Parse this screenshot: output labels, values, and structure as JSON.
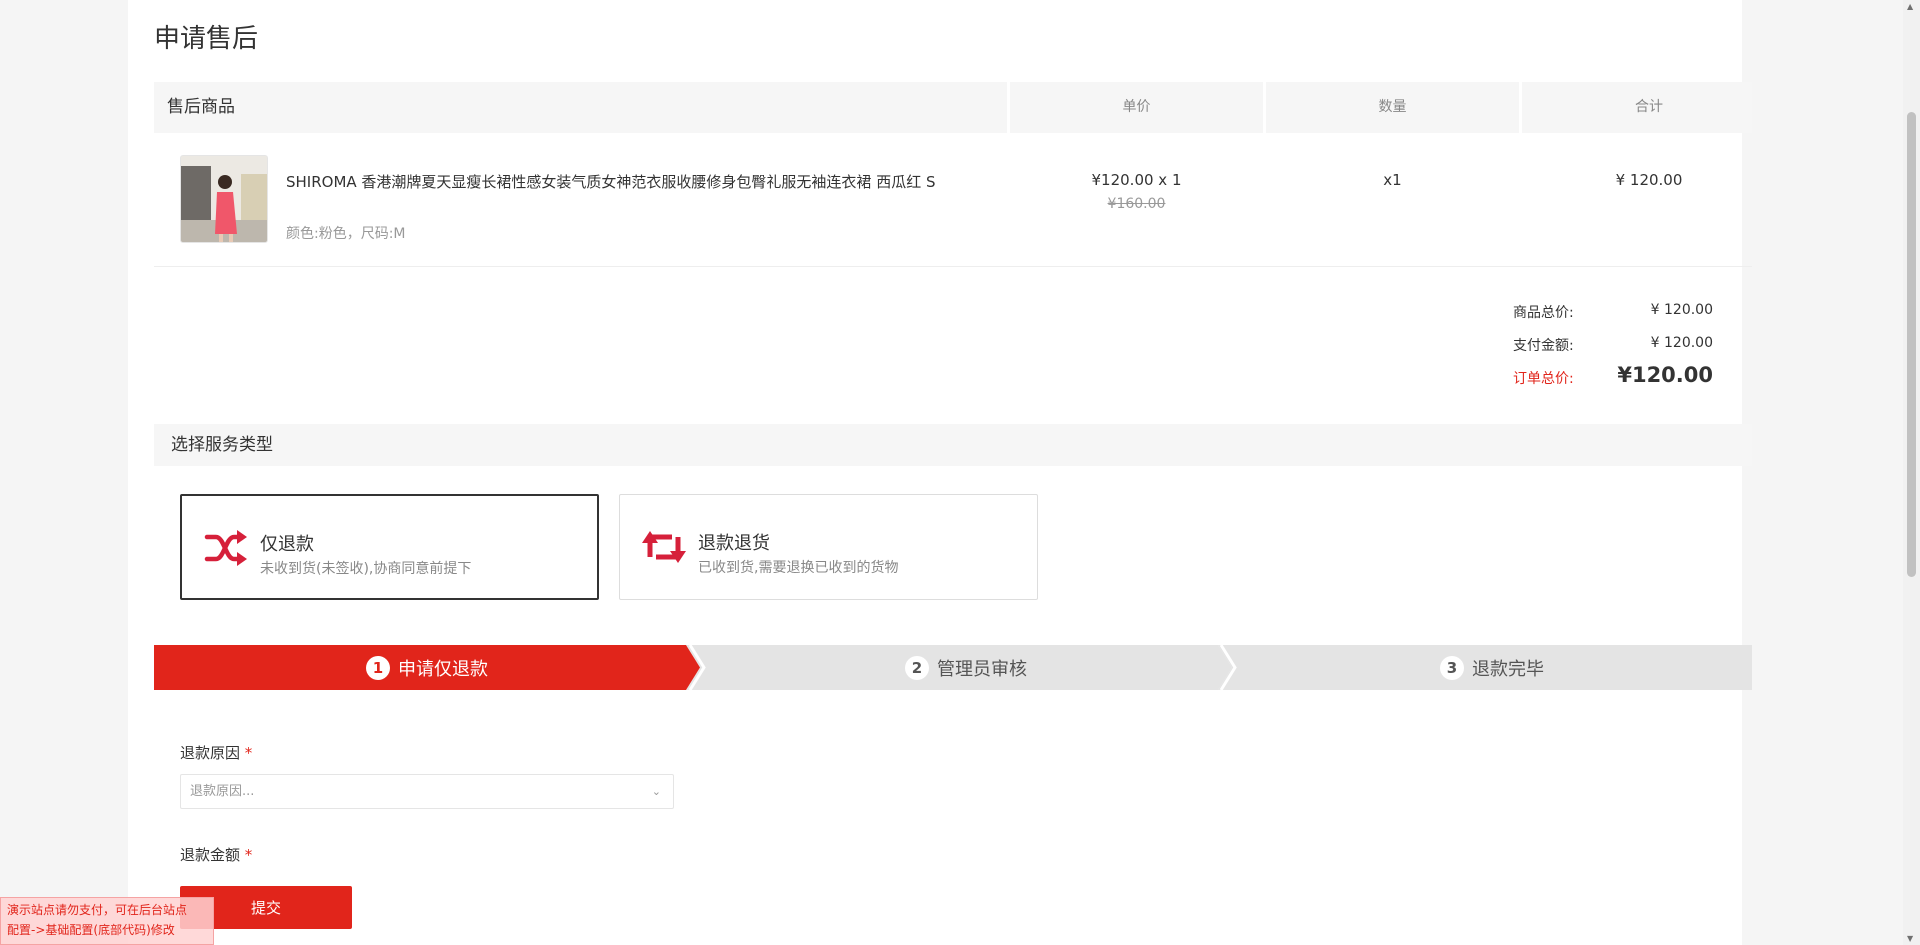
{
  "page": {
    "title": "申请售后"
  },
  "goods_table": {
    "headers": [
      "售后商品",
      "单价",
      "数量",
      "合计"
    ],
    "item": {
      "name": "SHIROMA 香港潮牌夏天显瘦长裙性感女装气质女神范衣服收腰修身包臀礼服无袖连衣裙 西瓜红 S",
      "spec": "颜色:粉色，尺码:M",
      "price": "¥120.00 x 1",
      "original_price": "¥160.00",
      "quantity": "x1",
      "total": "¥ 120.00"
    }
  },
  "totals": {
    "goods_total_label": "商品总价:",
    "goods_total_value": "¥ 120.00",
    "paid_label": "支付金额:",
    "paid_value": "¥ 120.00",
    "order_total_label": "订单总价:",
    "order_total_value": "¥120.00"
  },
  "service": {
    "section_title": "选择服务类型",
    "options": [
      {
        "title": "仅退款",
        "desc": "未收到货(未签收),协商同意前提下",
        "icon": "shuffle-icon",
        "selected": true
      },
      {
        "title": "退款退货",
        "desc": "已收到货,需要退换已收到的货物",
        "icon": "exchange-icon",
        "selected": false
      }
    ]
  },
  "steps": [
    {
      "num": "1",
      "label": "申请仅退款",
      "active": true
    },
    {
      "num": "2",
      "label": "管理员审核",
      "active": false
    },
    {
      "num": "3",
      "label": "退款完毕",
      "active": false
    }
  ],
  "form": {
    "reason_label": "退款原因",
    "reason_placeholder": "退款原因...",
    "amount_label": "退款金额",
    "required_mark": "*",
    "submit_label": "提交"
  },
  "notice": {
    "line1": "演示站点请勿支付，可在后台站点",
    "line2": "配置->基础配置(底部代码)修改"
  },
  "colors": {
    "accent": "#e1251b",
    "icon_red": "#d6203a",
    "step_inactive": "#e6e6e6"
  }
}
